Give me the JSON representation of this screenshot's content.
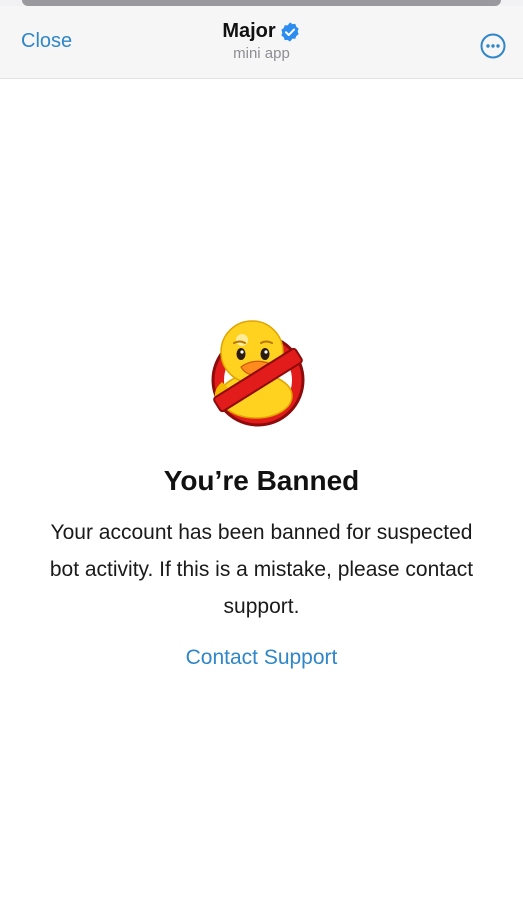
{
  "header": {
    "close_label": "Close",
    "title": "Major",
    "subtitle": "mini app",
    "verified_icon": "verified-badge-icon",
    "more_icon": "more-options-icon"
  },
  "main": {
    "illustration": "banned-duck-icon",
    "heading": "You’re Banned",
    "message": "Your account has been banned for suspected bot activity. If this is a mistake, please contact support.",
    "support_link": "Contact Support"
  },
  "colors": {
    "accent": "#2f86c8",
    "verified": "#2d8cf0",
    "ban_red": "#e21b1b",
    "duck_yellow": "#ffd21f"
  }
}
